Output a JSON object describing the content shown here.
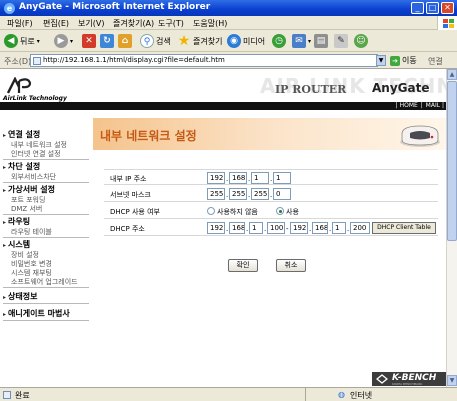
{
  "window": {
    "title": "AnyGate - Microsoft Internet Explorer"
  },
  "menu": [
    "파일(F)",
    "편집(E)",
    "보기(V)",
    "즐겨찾기(A)",
    "도구(T)",
    "도움말(H)"
  ],
  "toolbar": {
    "back": "뒤로",
    "search": "검색",
    "favorites": "즐겨찾기",
    "media": "미디어"
  },
  "address": {
    "label": "주소(D)",
    "url": "http://192.168.1.1/html/display.cgi?file=default.htm",
    "go": "이동",
    "links": "연결"
  },
  "header": {
    "logo": "AirLink Technology",
    "brand_bg": "AIR LINK TECHNOLOGY",
    "product": "IP ROUTER",
    "model": "AnyGate",
    "nav": [
      "| HOME",
      "|",
      "MAIL |"
    ]
  },
  "sidebar": {
    "sections": [
      {
        "title": "연결 설정",
        "items": [
          "내부 네트워크 설정",
          "인터넷 연결 설정"
        ]
      },
      {
        "title": "차단 설정",
        "items": [
          "외부서비스차단"
        ]
      },
      {
        "title": "가상서버 설정",
        "items": [
          "포트 포워딩",
          "DMZ 서버"
        ]
      },
      {
        "title": "라우팅",
        "items": [
          "라우팅 테이블"
        ]
      },
      {
        "title": "시스템",
        "items": [
          "장비 설정",
          "비밀번호 변경",
          "시스템 재부팅",
          "소프트웨어 업그레이드"
        ]
      },
      {
        "title": "상태정보",
        "items": []
      },
      {
        "title": "애니게이트 마법사",
        "items": []
      }
    ]
  },
  "page": {
    "heading": "내부 네트워크 설정"
  },
  "form": {
    "ip_label": "내부 IP 주소",
    "ip": [
      "192",
      "168",
      "1",
      "1"
    ],
    "subnet_label": "서브넷 마스크",
    "subnet": [
      "255",
      "255",
      "255",
      "0"
    ],
    "dhcp_use_label": "DHCP 사용 여부",
    "dhcp_off": "사용하지 않음",
    "dhcp_on": "사용",
    "dhcp_range_label": "DHCP 주소",
    "dhcp_start": [
      "192",
      "168",
      "1",
      "100"
    ],
    "dhcp_end": [
      "192",
      "168",
      "1",
      "200"
    ],
    "client_table_button": "DHCP Client Table"
  },
  "actions": {
    "ok": "확인",
    "cancel": "취소"
  },
  "status": {
    "text": "완료",
    "zone": "인터넷"
  },
  "footer": {
    "brand": "K-BENCH",
    "sub": "KOREA BENCHMARK"
  },
  "colors": {
    "heading": "#c45a14",
    "titlebar": "#0a3fd0"
  }
}
